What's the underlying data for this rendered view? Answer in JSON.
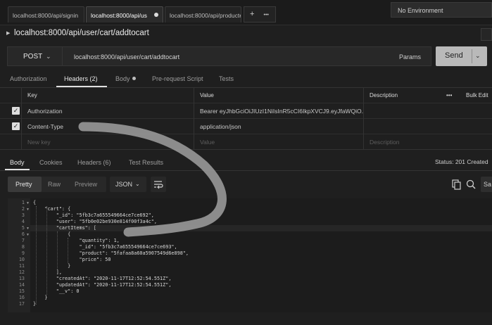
{
  "tabs": [
    {
      "label": "localhost:8000/api/signin",
      "active": false
    },
    {
      "label": "localhost:8000/api/us",
      "active": true,
      "modified": true
    },
    {
      "label": "localhost:8000/api/producte",
      "active": false
    }
  ],
  "tabs_actions": {
    "add": "+",
    "more": "•••"
  },
  "environment": {
    "label": "No Environment"
  },
  "request": {
    "title": "localhost:8000/api/user/cart/addtocart",
    "method": "POST",
    "url": "localhost:8000/api/user/cart/addtocart",
    "params_label": "Params",
    "send_label": "Send"
  },
  "request_tabs": {
    "authorization": "Authorization",
    "headers": "Headers (2)",
    "body": "Body",
    "prerequest": "Pre-request Script",
    "tests": "Tests"
  },
  "headers_table": {
    "columns": {
      "key": "Key",
      "value": "Value",
      "description": "Description",
      "more": "•••",
      "bulk_edit": "Bulk Edit"
    },
    "rows": [
      {
        "key": "Authorization",
        "value": "Bearer eyJhbGciOiJIUzI1NiIsInR5cCI6IkpXVCJ9.eyJfaWQiO...",
        "checked": true
      },
      {
        "key": "Content-Type",
        "value": "application/json",
        "checked": true
      }
    ],
    "placeholder": {
      "key": "New key",
      "value": "Value",
      "description": "Description"
    }
  },
  "response_tabs": {
    "body": "Body",
    "cookies": "Cookies",
    "headers": "Headers (6)",
    "test_results": "Test Results"
  },
  "status": "Status: 201 Created",
  "response_toolbar": {
    "pretty": "Pretty",
    "raw": "Raw",
    "preview": "Preview",
    "format": "JSON",
    "save_stub": "Sa"
  },
  "icons": {
    "copy": "copy-icon",
    "search": "search-icon",
    "wrap": "wrap-icon"
  },
  "code_lines": [
    {
      "n": "1",
      "text": "{",
      "fold": true
    },
    {
      "n": "2",
      "text": "    \"cart\": {",
      "fold": true
    },
    {
      "n": "3",
      "text": "        \"_id\": \"5fb3c7a655549664ce7ce692\",",
      "fold": false
    },
    {
      "n": "4",
      "text": "        \"user\": \"5fb0e02be930e814f00f3a4c\",",
      "fold": false
    },
    {
      "n": "5",
      "text": "        \"cartItems\": [",
      "fold": true
    },
    {
      "n": "6",
      "text": "            {",
      "fold": true
    },
    {
      "n": "7",
      "text": "                \"quantity\": 1,",
      "fold": false
    },
    {
      "n": "8",
      "text": "                \"_id\": \"5fb3c7a655549664ce7ce693\",",
      "fold": false
    },
    {
      "n": "9",
      "text": "                \"product\": \"5fafaa8a60a5907549d6e898\",",
      "fold": false
    },
    {
      "n": "10",
      "text": "                \"price\": 50",
      "fold": false
    },
    {
      "n": "11",
      "text": "            }",
      "fold": false
    },
    {
      "n": "12",
      "text": "        ],",
      "fold": false
    },
    {
      "n": "13",
      "text": "        \"createdAt\": \"2020-11-17T12:52:54.551Z\",",
      "fold": false
    },
    {
      "n": "14",
      "text": "        \"updatedAt\": \"2020-11-17T12:52:54.551Z\",",
      "fold": false
    },
    {
      "n": "15",
      "text": "        \"__v\": 0",
      "fold": false
    },
    {
      "n": "16",
      "text": "    }",
      "fold": false
    },
    {
      "n": "17",
      "text": "}",
      "fold": false
    }
  ],
  "colors": {
    "background": "#1f1f1f",
    "send_button": "#b9b9b9",
    "annotation_stroke": "#a0a0a0"
  }
}
